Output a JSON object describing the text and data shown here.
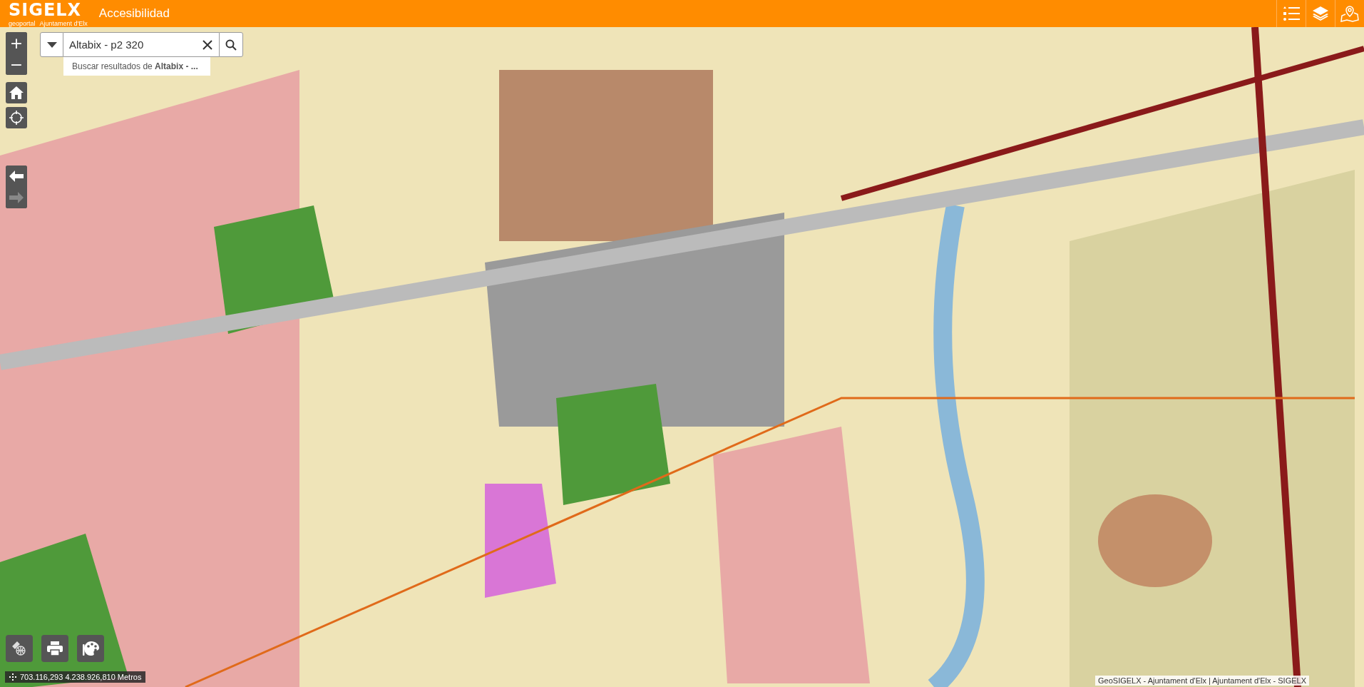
{
  "header": {
    "logo": "SIGELX",
    "logo_sub": [
      "geoportal",
      "Ajuntament d'Elx"
    ],
    "title": "Accesibilidad",
    "tools": [
      {
        "kind": "legend"
      },
      {
        "kind": "layers"
      },
      {
        "kind": "map-pin"
      }
    ]
  },
  "zoom_controls": [
    {
      "label": "+"
    },
    {
      "label": "−"
    }
  ],
  "nav_buttons": [
    {
      "kind": "back",
      "disabled": false
    },
    {
      "kind": "forward",
      "disabled": true
    }
  ],
  "search": {
    "value": "Altabix - p2 320",
    "suggestion": "Buscar resultados de **Altabix - ...**"
  },
  "bottom_tools": [
    {
      "kind": "measure"
    },
    {
      "kind": "print"
    },
    {
      "kind": "style"
    }
  ],
  "coordinates": "703.116,293 4.238.926,810 Metros",
  "attribution": "GeoSIGELX - Ajuntament d'Elx | Ajuntament d'Elx - SIGELX"
}
